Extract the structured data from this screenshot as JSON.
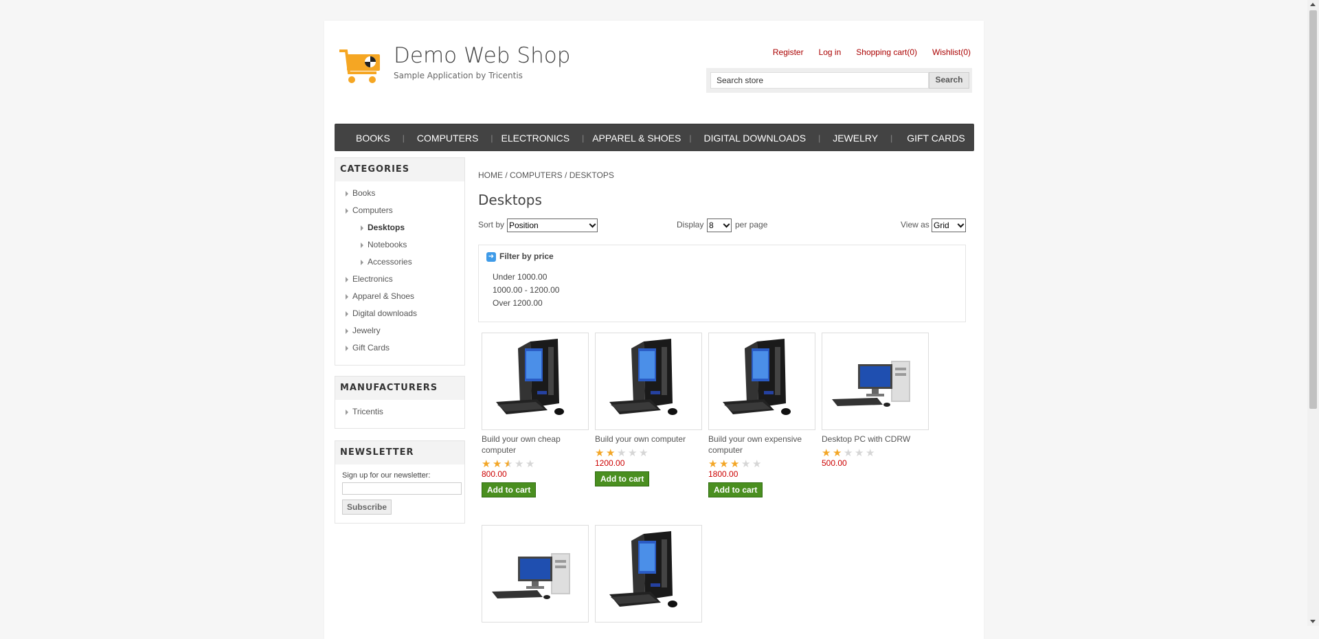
{
  "header": {
    "title": "Demo Web Shop",
    "subtitle": "Sample Application by Tricentis",
    "links": [
      "Register",
      "Log in",
      "Shopping cart(0)",
      "Wishlist(0)"
    ],
    "search_placeholder": "Search store",
    "search_button": "Search"
  },
  "top_menu": [
    "BOOKS",
    "COMPUTERS",
    "ELECTRONICS",
    "APPAREL & SHOES",
    "DIGITAL DOWNLOADS",
    "JEWELRY",
    "GIFT CARDS"
  ],
  "categories": {
    "title": "CATEGORIES",
    "items": [
      "Books",
      "Computers",
      "Desktops",
      "Notebooks",
      "Accessories",
      "Electronics",
      "Apparel & Shoes",
      "Digital downloads",
      "Jewelry",
      "Gift Cards"
    ]
  },
  "manufacturers": {
    "title": "MANUFACTURERS",
    "items": [
      "Tricentis"
    ]
  },
  "newsletter": {
    "title": "NEWSLETTER",
    "label": "Sign up for our newsletter:",
    "button": "Subscribe"
  },
  "breadcrumb": [
    "HOME",
    "COMPUTERS",
    "DESKTOPS"
  ],
  "page_title": "Desktops",
  "toolbar": {
    "sort_label": "Sort by",
    "sort_value": "Position",
    "display_label": "Display",
    "display_value": "8",
    "per_page": "per page",
    "view_label": "View as",
    "view_value": "Grid"
  },
  "filter": {
    "title": "Filter by price",
    "options": [
      "Under 1000.00",
      "1000.00 - 1200.00",
      "Over 1200.00"
    ]
  },
  "products": [
    {
      "name": "Build your own cheap computer",
      "rating": 2.5,
      "price": "800.00",
      "button": "Add to cart",
      "image": "tower-pc"
    },
    {
      "name": "Build your own computer",
      "rating": 2,
      "price": "1200.00",
      "button": "Add to cart",
      "image": "tower-pc"
    },
    {
      "name": "Build your own expensive computer",
      "rating": 3,
      "price": "1800.00",
      "button": "Add to cart",
      "image": "tower-pc"
    },
    {
      "name": "Desktop PC with CDRW",
      "rating": 2,
      "price": "500.00",
      "button": "",
      "image": "desktop-pc"
    },
    {
      "name": "",
      "rating": null,
      "price": "",
      "button": "",
      "image": "desktop-pc"
    },
    {
      "name": "",
      "rating": null,
      "price": "",
      "button": "",
      "image": "tower-pc"
    }
  ],
  "colors": {
    "link_red": "#aa0000",
    "menu_bg": "#434343",
    "price_red": "#cc0000",
    "add_green": "#4a8f20",
    "star": "#f3a626"
  }
}
